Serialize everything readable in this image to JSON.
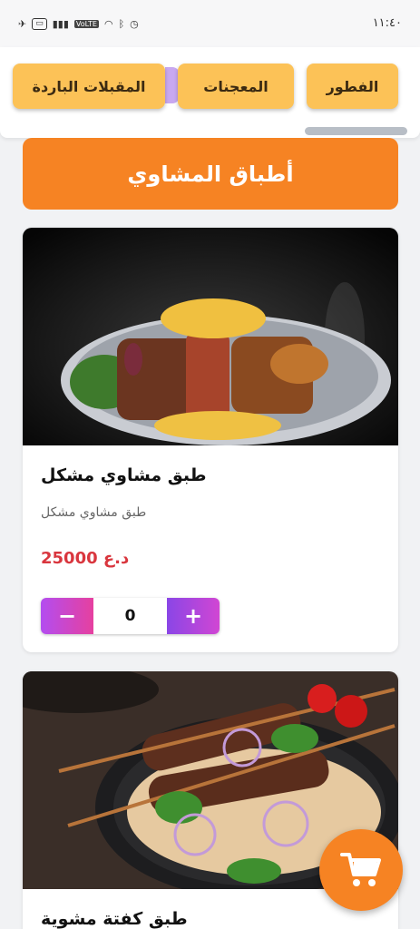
{
  "status_bar": {
    "time": "١١:٤٠",
    "network_label": "VoLTE"
  },
  "tabs": [
    {
      "label": "الفطور"
    },
    {
      "label": "المعجنات"
    },
    {
      "label": "المقبلات الباردة"
    }
  ],
  "section": {
    "title": "أطباق المشاوي"
  },
  "products": [
    {
      "title": "طبق مشاوي مشكل",
      "description": "طبق مشاوي مشكل",
      "price": "25000 د.ع",
      "quantity": "0",
      "minus_label": "−",
      "plus_label": "+"
    },
    {
      "title": "طبق كفتة مشوية"
    }
  ],
  "cart": {
    "icon": "cart-icon"
  },
  "colors": {
    "accent": "#f68323",
    "tab_bg": "#fcc257",
    "price": "#d9363e",
    "stepper_gradient_start": "#b34df0",
    "stepper_gradient_end": "#e6409f"
  }
}
